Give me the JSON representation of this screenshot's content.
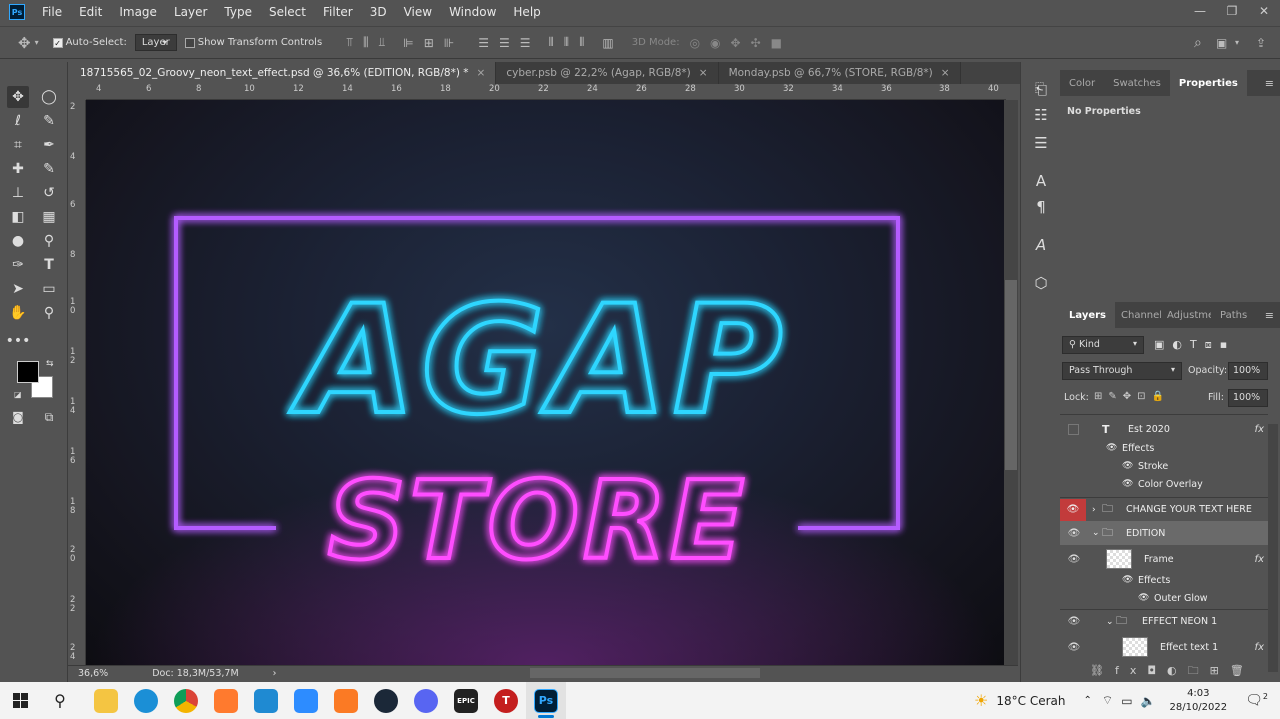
{
  "app": {
    "logo": "Ps",
    "menu": [
      "File",
      "Edit",
      "Image",
      "Layer",
      "Type",
      "Select",
      "Filter",
      "3D",
      "View",
      "Window",
      "Help"
    ]
  },
  "options": {
    "auto_select_label": "Auto-Select:",
    "auto_select_value": "Layer",
    "show_transform_label": "Show Transform Controls",
    "mode_3d_label": "3D Mode:"
  },
  "tabs": [
    {
      "label": "18715565_02_Groovy_neon_text_effect.psd @ 36,6% (EDITION, RGB/8*) *",
      "close": "×"
    },
    {
      "label": "cyber.psb @ 22,2% (Agap, RGB/8*)",
      "close": "×"
    },
    {
      "label": "Monday.psb @ 66,7% (STORE, RGB/8*)",
      "close": "×"
    }
  ],
  "ruler": {
    "h": [
      "4",
      "6",
      "8",
      "10",
      "12",
      "14",
      "16",
      "18",
      "20",
      "22",
      "24",
      "26",
      "28",
      "30",
      "32",
      "34",
      "36",
      "38",
      "40"
    ],
    "v": [
      "2",
      "4",
      "6",
      "8",
      "1 0",
      "1 2",
      "1 4",
      "1 6",
      "1 8",
      "2 0",
      "2 2",
      "2 4"
    ]
  },
  "artwork": {
    "line1": "AGAP",
    "line2": "STORE",
    "cyan": "#2fd6ff",
    "magenta": "#ff4dff",
    "frame": "#b45cff"
  },
  "status": {
    "zoom": "36,6%",
    "doc": "Doc: 18,3M/53,7M"
  },
  "panels": {
    "top_tabs": [
      "Color",
      "Swatches",
      "Properties"
    ],
    "no_properties": "No Properties",
    "layer_tabs": [
      "Layers",
      "Channels",
      "Adjustments",
      "Paths"
    ],
    "kind": "Kind",
    "blend": "Pass Through",
    "opacity_label": "Opacity:",
    "opacity": "100%",
    "lock_label": "Lock:",
    "fill_label": "Fill:",
    "fill": "100%",
    "layers": [
      {
        "name": "Est 2020",
        "type": "text",
        "fx": "fx"
      },
      {
        "name": "Effects",
        "type": "effects"
      },
      {
        "name": "Stroke",
        "type": "effect"
      },
      {
        "name": "Color Overlay",
        "type": "effect"
      },
      {
        "name": "CHANGE YOUR TEXT HERE",
        "type": "group"
      },
      {
        "name": "EDITION",
        "type": "group"
      },
      {
        "name": "Frame",
        "type": "smart",
        "fx": "fx"
      },
      {
        "name": "Effects",
        "type": "effects"
      },
      {
        "name": "Outer Glow",
        "type": "effect"
      },
      {
        "name": "EFFECT NEON 1",
        "type": "group"
      },
      {
        "name": "Effect text 1",
        "type": "smart",
        "fx": "fx"
      }
    ]
  },
  "taskbar": {
    "weather": "18°C  Cerah",
    "time": "4:03",
    "date": "28/10/2022",
    "notif": "2",
    "apps": [
      "search-icon",
      "file-explorer-icon",
      "edge-icon",
      "chrome-icon",
      "paint-icon",
      "vscode-icon",
      "zoom-icon",
      "xampp-icon",
      "steam-icon",
      "discord-icon",
      "epic-games-icon",
      "toolbox-icon",
      "photoshop-icon"
    ],
    "epic": "EPIC",
    "ps": "Ps",
    "t": "T"
  }
}
